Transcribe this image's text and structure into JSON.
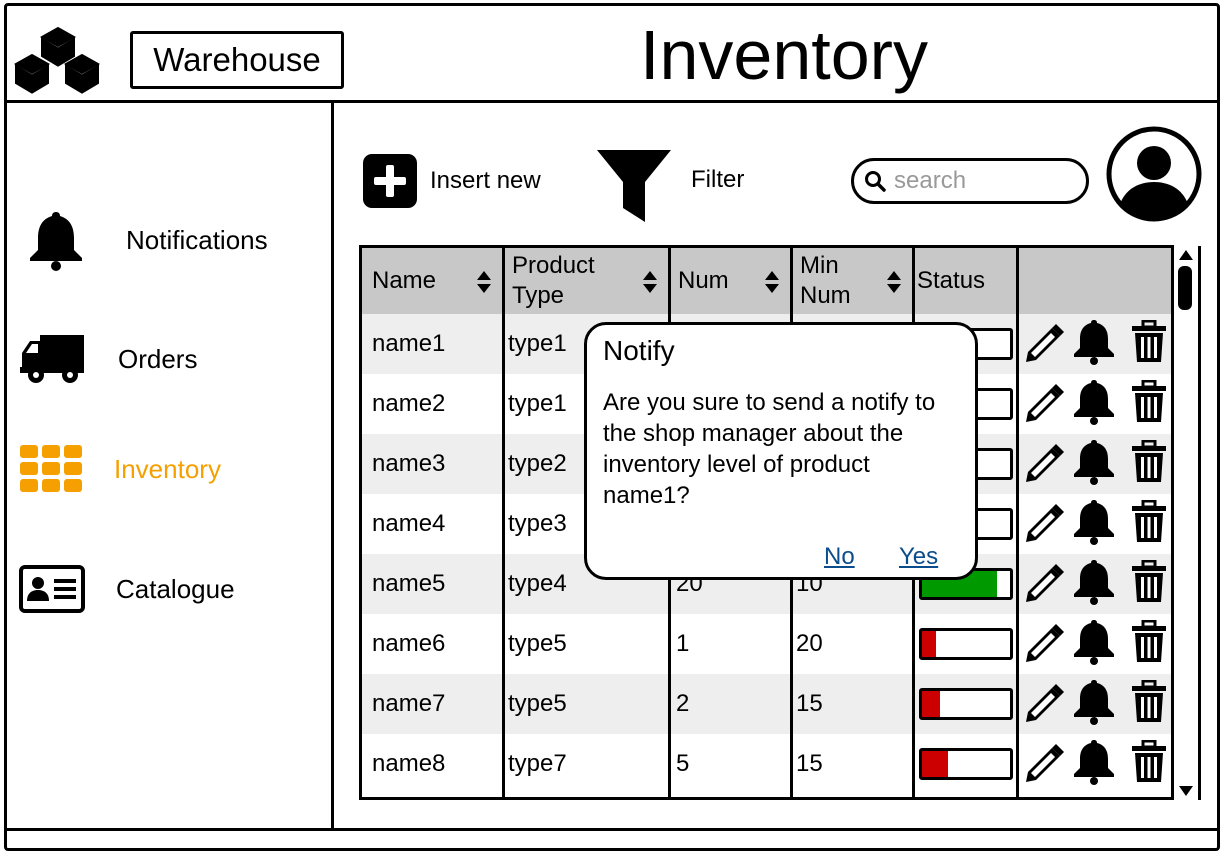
{
  "header": {
    "brand": "Warehouse",
    "title": "Inventory"
  },
  "sidebar": {
    "items": [
      {
        "label": "Notifications",
        "icon": "bell-icon"
      },
      {
        "label": "Orders",
        "icon": "truck-icon"
      },
      {
        "label": "Inventory",
        "icon": "grid-icon",
        "active": true
      },
      {
        "label": "Catalogue",
        "icon": "id-card-icon"
      }
    ],
    "active_color": "#f5a000"
  },
  "toolbar": {
    "insert_label": "Insert new",
    "filter_label": "Filter",
    "search_placeholder": "search"
  },
  "table": {
    "headers": [
      {
        "label": "Name",
        "sortable": true
      },
      {
        "label": "Product Type",
        "sortable": true
      },
      {
        "label": "Num",
        "sortable": true
      },
      {
        "label": "Min Num",
        "sortable": true
      },
      {
        "label": "Status",
        "sortable": false
      }
    ],
    "rows": [
      {
        "name": "name1",
        "type": "type1",
        "num": "",
        "min": "",
        "level": 0.0,
        "color": "#cc0000"
      },
      {
        "name": "name2",
        "type": "type1",
        "num": "",
        "min": "",
        "level": 0.0,
        "color": "#cc0000"
      },
      {
        "name": "name3",
        "type": "type2",
        "num": "",
        "min": "",
        "level": 0.2,
        "color": "#009900"
      },
      {
        "name": "name4",
        "type": "type3",
        "num": "",
        "min": "",
        "level": 0.5,
        "color": "#009900"
      },
      {
        "name": "name5",
        "type": "type4",
        "num": "20",
        "min": "10",
        "level": 0.85,
        "color": "#009900"
      },
      {
        "name": "name6",
        "type": "type5",
        "num": "1",
        "min": "20",
        "level": 0.16,
        "color": "#cc0000"
      },
      {
        "name": "name7",
        "type": "type5",
        "num": "2",
        "min": "15",
        "level": 0.2,
        "color": "#cc0000"
      },
      {
        "name": "name8",
        "type": "type7",
        "num": "5",
        "min": "15",
        "level": 0.3,
        "color": "#cc0000"
      }
    ]
  },
  "dialog": {
    "title": "Notify",
    "message": "Are you sure to send a notify to the shop manager about the inventory level of product name1?",
    "no_label": "No",
    "yes_label": "Yes"
  }
}
